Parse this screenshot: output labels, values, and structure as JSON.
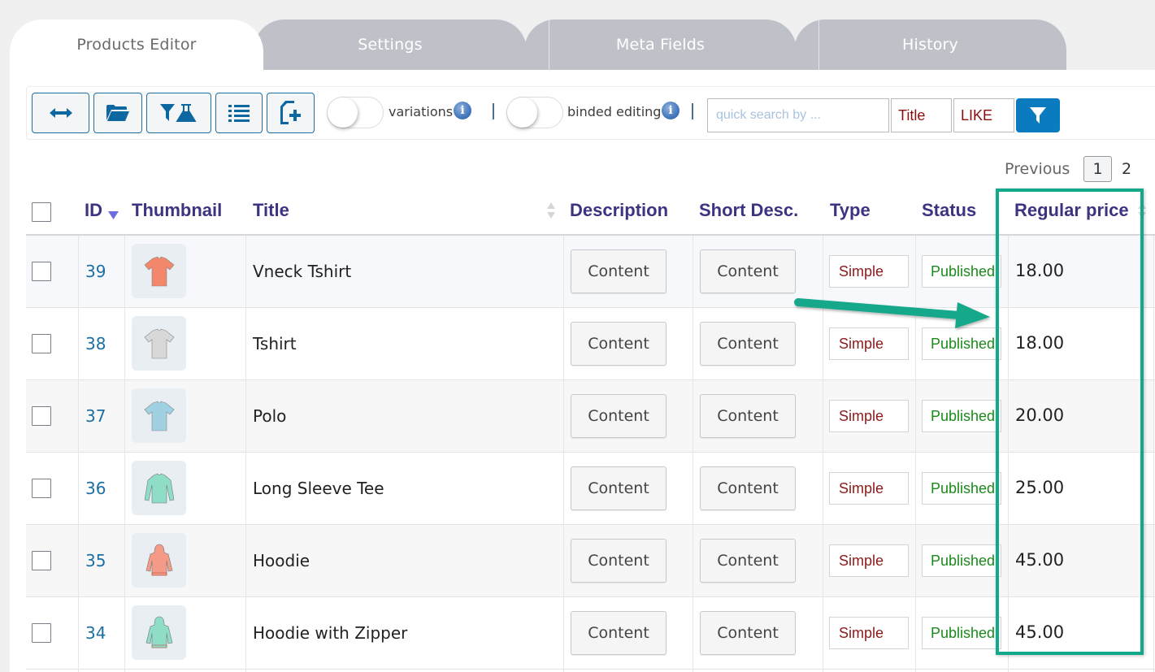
{
  "tabs": [
    {
      "label": "Products Editor",
      "active": true
    },
    {
      "label": "Settings",
      "active": false
    },
    {
      "label": "Meta Fields",
      "active": false
    },
    {
      "label": "History",
      "active": false
    },
    {
      "label": "",
      "active": false
    }
  ],
  "toolbar": {
    "buttons": [
      {
        "icon": "expand-horizontal-icon"
      },
      {
        "icon": "folder-open-icon"
      },
      {
        "icon": "filter-flask-icon"
      },
      {
        "icon": "list-icon"
      },
      {
        "icon": "add-file-icon"
      }
    ],
    "variations_label": "variations",
    "variations_on": false,
    "binded_label": "binded editing",
    "binded_on": false,
    "info_glyph": "i",
    "search_placeholder": "quick search by ...",
    "search_value": "",
    "field_value": "Title",
    "operator_value": "LIKE"
  },
  "pagination": {
    "previous_label": "Previous",
    "pages": [
      "1",
      "2"
    ],
    "current": "1"
  },
  "table": {
    "columns": [
      "ID",
      "Thumbnail",
      "Title",
      "Description",
      "Short Desc.",
      "Type",
      "Status",
      "Regular price"
    ],
    "sort_column": "ID",
    "sort_direction": "desc",
    "rows": [
      {
        "id": "39",
        "title": "Vneck Tshirt",
        "thumb": "vneck-tshirt",
        "description": "Content",
        "short_desc": "Content",
        "type": "Simple",
        "status": "Published",
        "price": "18.00"
      },
      {
        "id": "38",
        "title": "Tshirt",
        "thumb": "tshirt",
        "description": "Content",
        "short_desc": "Content",
        "type": "Simple",
        "status": "Published",
        "price": "18.00"
      },
      {
        "id": "37",
        "title": "Polo",
        "thumb": "polo",
        "description": "Content",
        "short_desc": "Content",
        "type": "Simple",
        "status": "Published",
        "price": "20.00"
      },
      {
        "id": "36",
        "title": "Long Sleeve Tee",
        "thumb": "long-sleeve-tee",
        "description": "Content",
        "short_desc": "Content",
        "type": "Simple",
        "status": "Published",
        "price": "25.00"
      },
      {
        "id": "35",
        "title": "Hoodie",
        "thumb": "hoodie",
        "description": "Content",
        "short_desc": "Content",
        "type": "Simple",
        "status": "Published",
        "price": "45.00"
      },
      {
        "id": "34",
        "title": "Hoodie with Zipper",
        "thumb": "hoodie-zipper",
        "description": "Content",
        "short_desc": "Content",
        "type": "Simple",
        "status": "Published",
        "price": "45.00"
      }
    ]
  },
  "annotation": {
    "highlighted_column": "Regular price",
    "color": "#12a88a"
  },
  "colors": {
    "header_text": "#3b3480",
    "id_link": "#1d6fa3",
    "type_text": "#8b1a1a",
    "status_text": "#1a8a1a",
    "filter_button": "#0b7bbf",
    "tab_inactive": "#bec2c8"
  }
}
